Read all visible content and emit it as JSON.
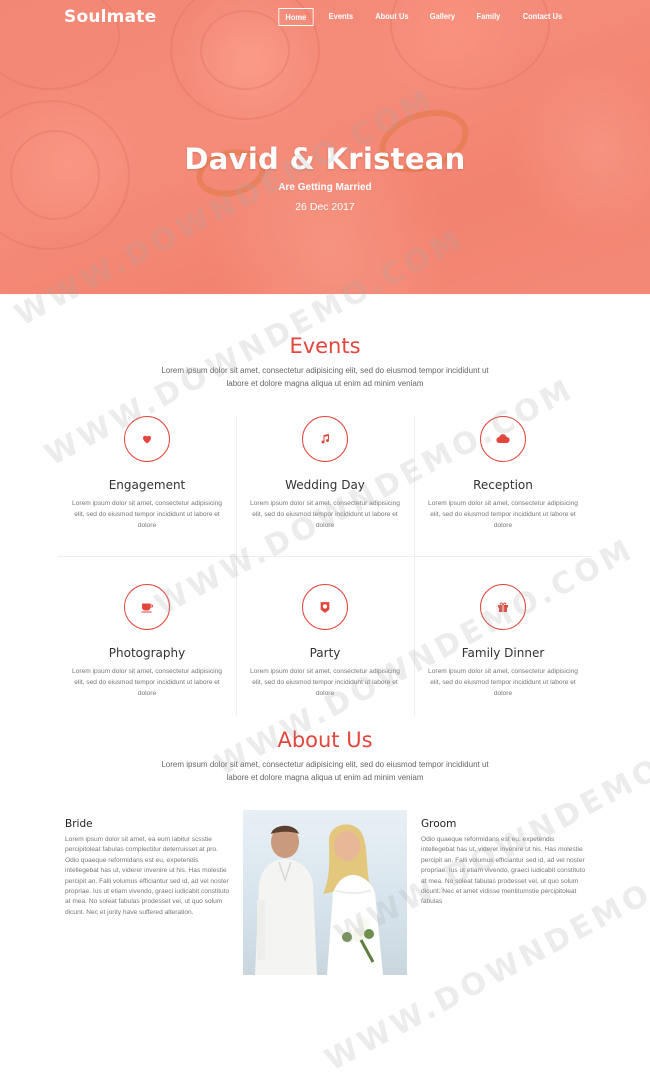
{
  "nav": {
    "logo": "Soulmate",
    "items": [
      {
        "label": "Home",
        "active": true
      },
      {
        "label": "Events"
      },
      {
        "label": "About Us"
      },
      {
        "label": "Gallery"
      },
      {
        "label": "Family"
      },
      {
        "label": "Contact Us"
      }
    ]
  },
  "hero": {
    "title": "David & Kristean",
    "subtitle": "Are Getting Married",
    "date": "26 Dec 2017"
  },
  "events": {
    "title": "Events",
    "description": "Lorem ipsum dolor sit amet, consectetur adipisicing elit, sed do eiusmod tempor incididunt ut labore et dolore magna aliqua ut enim ad minim veniam",
    "items": [
      {
        "name": "Engagement",
        "icon": "heart-icon",
        "text": "Lorem ipsum dolor sit amet, consectetur adipisicing elit, sed do eiusmod tempor incididunt ut labore et dolore"
      },
      {
        "name": "Wedding Day",
        "icon": "music-icon",
        "text": "Lorem ipsum dolor sit amet, consectetur adipisicing elit, sed do eiusmod tempor incididunt ut labore et dolore"
      },
      {
        "name": "Reception",
        "icon": "cloud-icon",
        "text": "Lorem ipsum dolor sit amet, consectetur adipisicing elit, sed do eiusmod tempor incididunt ut labore et dolore"
      },
      {
        "name": "Photography",
        "icon": "cup-icon",
        "text": "Lorem ipsum dolor sit amet, consectetur adipisicing elit, sed do eiusmod tempor incididunt ut labore et dolore"
      },
      {
        "name": "Party",
        "icon": "badge-icon",
        "text": "Lorem ipsum dolor sit amet, consectetur adipisicing elit, sed do eiusmod tempor incididunt ut labore et dolore"
      },
      {
        "name": "Family Dinner",
        "icon": "gift-icon",
        "text": "Lorem ipsum dolor sit amet, consectetur adipisicing elit, sed do eiusmod tempor incididunt ut labore et dolore"
      }
    ]
  },
  "about": {
    "title": "About Us",
    "description": "Lorem ipsum dolor sit amet, consectetur adipisicing elit, sed do eiusmod tempor incididunt ut labore et dolore magna aliqua ut enim ad minim veniam",
    "bride": {
      "title": "Bride",
      "text": "Lorem ipsum dolor sit amet, ea eum labitur scsstie percipitoleat fabulas complectitur deterruisset at pro. Odio quaeque reformidans est eu, expetendis intellegebat has ut, viderer invenire ut his. Has molestie percipit an. Falli volumus efficiantur sed id, ad vel noster propriae. Ius ut etiam vivendo, graeci iudicabit constituto at mea. No soleat fabulas prodesset vel, ut quo solum dicunt. Nec et jority have suffered alteration."
    },
    "groom": {
      "title": "Groom",
      "text": "Odio quaeque reformidans est eu, expetendis intellegebat has ut, viderer invenire ut his. Has molestie percipit an. Falli volumus efficiantur sed id, ad vel noster propriae. Ius ut etiam vivendo, graeci iudicabit constituto at mea. No soleat fabulas prodesset vel, ut quo solum dicunt. Nec et amet vidisse mentitumstie percipitoleat fabulas"
    }
  },
  "watermark": "WWW.DOWNDEMO.COM",
  "colors": {
    "accent": "#e2463d",
    "hero": "#f48a78"
  }
}
